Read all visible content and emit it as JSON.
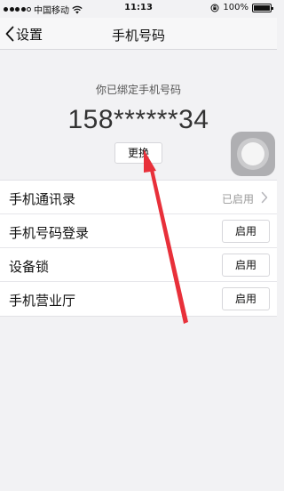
{
  "status_bar": {
    "carrier": "中国移动",
    "time": "11:13",
    "battery": "100%",
    "signal_bars_filled": 4,
    "signal_bars_total": 5
  },
  "nav": {
    "back_label": "设置",
    "title": "手机号码"
  },
  "phone": {
    "hint": "你已绑定手机号码",
    "number": "158******34",
    "change_label": "更换"
  },
  "list": {
    "items": [
      {
        "label": "手机通讯录",
        "status": "已启用"
      },
      {
        "label": "手机号码登录",
        "button": "启用"
      },
      {
        "label": "设备锁",
        "button": "启用"
      },
      {
        "label": "手机营业厅",
        "button": "启用"
      }
    ]
  },
  "colors": {
    "background": "#f2f2f4",
    "annotation_arrow": "#e8303a"
  },
  "icons": {
    "back": "chevron-left-icon",
    "row_disclosure": "chevron-right-icon",
    "assistive_touch": "assistive-touch-icon"
  }
}
